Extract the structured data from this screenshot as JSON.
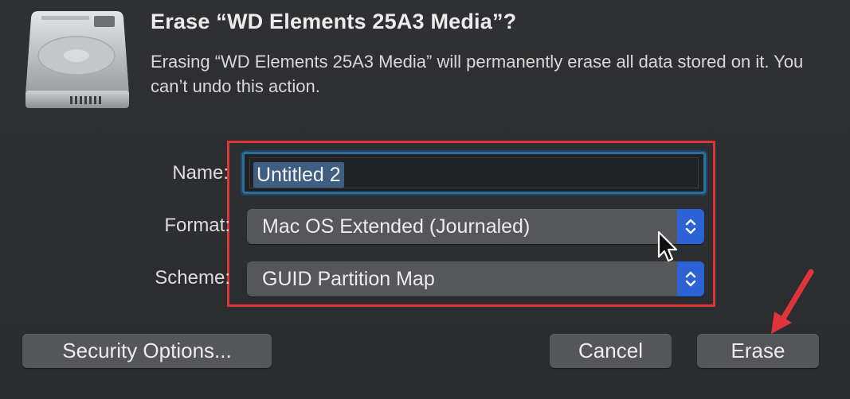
{
  "dialog": {
    "title": "Erase “WD Elements 25A3 Media”?",
    "message": "Erasing “WD Elements 25A3 Media” will permanently erase all data stored on it. You can’t undo this action."
  },
  "form": {
    "name_label": "Name:",
    "name_value": "Untitled 2",
    "format_label": "Format:",
    "format_value": "Mac OS Extended (Journaled)",
    "scheme_label": "Scheme:",
    "scheme_value": "GUID Partition Map"
  },
  "buttons": {
    "security_options": "Security Options...",
    "cancel": "Cancel",
    "erase": "Erase"
  },
  "icons": {
    "drive": "external-drive-icon",
    "stepper": "up-down-chevron-icon",
    "cursor": "mouse-pointer-icon",
    "annotation_arrow": "red-arrow-annotation-icon"
  },
  "colors": {
    "background": "#2b2d30",
    "highlight_border": "#e0343b",
    "accent_blue": "#2b63d6",
    "focus_ring": "#2d6f99",
    "button": "#54565a"
  }
}
